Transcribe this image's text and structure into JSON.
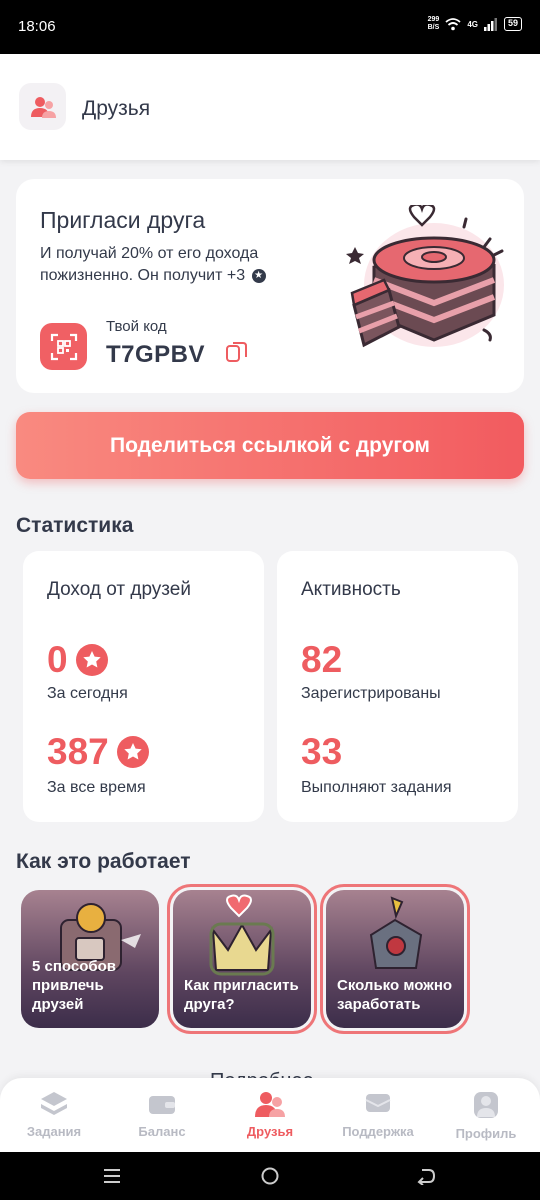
{
  "status_bar": {
    "time": "18:06",
    "net_speed_value": "299",
    "net_speed_unit": "B/S",
    "network": "4G",
    "battery": "59"
  },
  "header": {
    "icon": "friends-icon",
    "title": "Друзья"
  },
  "invite": {
    "title": "Пригласи друга",
    "text": "И получай 20% от его дохода пожизненно. Он получит +3",
    "code_label": "Твой код",
    "code": "T7GPBV",
    "illustration": "cake-illustration"
  },
  "share_button": {
    "label": "Поделиться ссылкой с другом"
  },
  "stats": {
    "title": "Статистика",
    "income": {
      "title": "Доход от друзей",
      "today_value": "0",
      "today_label": "За сегодня",
      "total_value": "387",
      "total_label": "За все время"
    },
    "activity": {
      "title": "Активность",
      "registered_value": "82",
      "registered_label": "Зарегистрированы",
      "active_value": "33",
      "active_label": "Выполняют задания"
    }
  },
  "how": {
    "title": "Как это работает",
    "stories": [
      {
        "label": "5 способов привлечь друзей"
      },
      {
        "label": "Как пригласить друга?"
      },
      {
        "label": "Сколько можно заработать"
      }
    ],
    "next_section_peek": "Подробнее"
  },
  "nav": {
    "items": [
      {
        "label": "Задания",
        "icon": "layers-icon"
      },
      {
        "label": "Баланс",
        "icon": "wallet-icon"
      },
      {
        "label": "Друзья",
        "icon": "friends-icon"
      },
      {
        "label": "Поддержка",
        "icon": "chat-icon"
      },
      {
        "label": "Профиль",
        "icon": "profile-icon"
      }
    ],
    "active": "Друзья"
  },
  "colors": {
    "accent": "#ee5c60",
    "text": "#33394a",
    "background": "#f3f3f5"
  }
}
